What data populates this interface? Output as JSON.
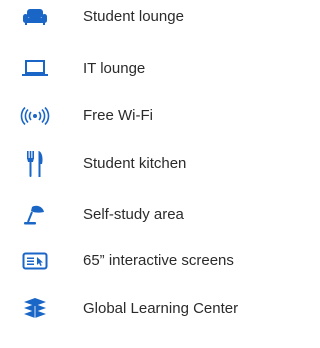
{
  "colors": {
    "icon": "#1a66c7",
    "text": "#2b2b2b",
    "background": "#ffffff"
  },
  "amenities": [
    {
      "icon": "sofa-icon",
      "label": "Student lounge"
    },
    {
      "icon": "laptop-icon",
      "label": "IT lounge"
    },
    {
      "icon": "wifi-icon",
      "label": "Free Wi-Fi"
    },
    {
      "icon": "fork-knife-icon",
      "label": "Student kitchen"
    },
    {
      "icon": "desk-lamp-icon",
      "label": "Self-study area"
    },
    {
      "icon": "interactive-screen-icon",
      "label": "65” interactive screens"
    },
    {
      "icon": "books-icon",
      "label": "Global Learning Center"
    }
  ]
}
